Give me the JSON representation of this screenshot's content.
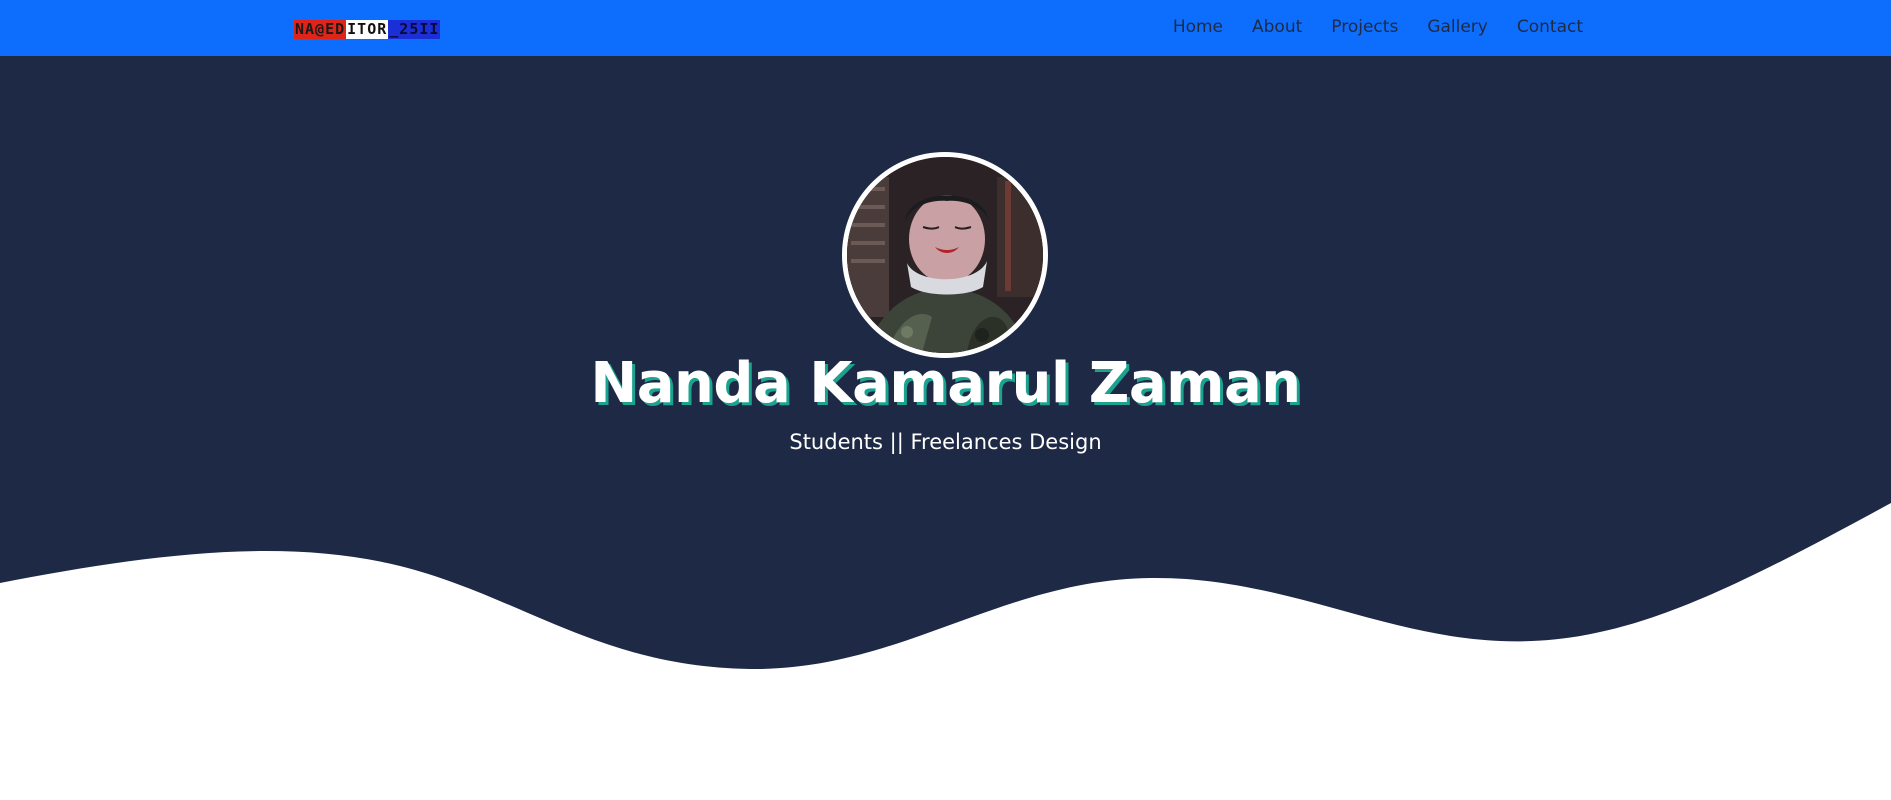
{
  "navbar": {
    "brand": {
      "part1": "NA@ED",
      "part2": "ITOR",
      "part3": "_25II"
    },
    "links": [
      {
        "label": "Home"
      },
      {
        "label": "About"
      },
      {
        "label": "Projects"
      },
      {
        "label": "Gallery"
      },
      {
        "label": "Contact"
      }
    ]
  },
  "hero": {
    "name": "Nanda Kamarul Zaman",
    "subtitle": "Students || Freelances Design"
  },
  "colors": {
    "navbar_bg": "#0d6efd",
    "hero_bg": "#1e2a45",
    "name_shadow": "#1ba38f",
    "page_bg": "#ffffff"
  }
}
